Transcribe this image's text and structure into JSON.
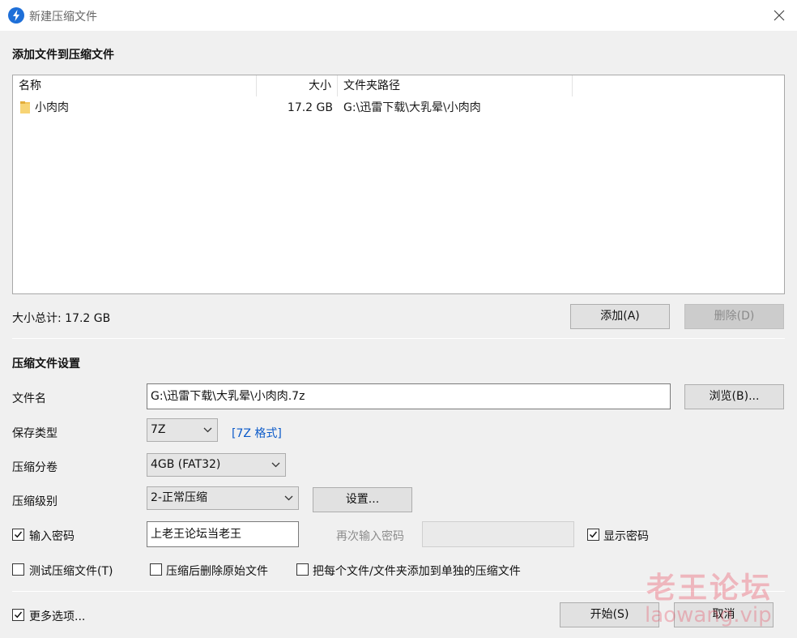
{
  "window": {
    "title": "新建压缩文件",
    "app_icon": "bolt-icon",
    "close_icon": "close-icon"
  },
  "files_section": {
    "title": "添加文件到压缩文件",
    "columns": [
      "名称",
      "大小",
      "文件夹路径"
    ],
    "rows": [
      {
        "name": "小肉肉",
        "size": "17.2 GB",
        "path": "G:\\迅雷下载\\大乳晕\\小肉肉",
        "icon": "folder-icon"
      }
    ],
    "total_size": "大小总计: 17.2 GB",
    "add_button": "添加(A)",
    "delete_button": "删除(D)"
  },
  "settings": {
    "title": "压缩文件设置",
    "filename_label": "文件名",
    "filename_value": "G:\\迅雷下载\\大乳晕\\小肉肉.7z",
    "browse_button": "浏览(B)...",
    "save_type_label": "保存类型",
    "save_type_value": "7Z",
    "format_link": "[7Z 格式]",
    "split_label": "压缩分卷",
    "split_value": "4GB (FAT32)",
    "level_label": "压缩级别",
    "level_value": "2-正常压缩",
    "settings_button": "设置...",
    "password_checkbox": {
      "label": "输入密码",
      "checked": true
    },
    "password_value": "上老王论坛当老王",
    "reenter_password_label": "再次输入密码",
    "reenter_password_value": "",
    "show_password": {
      "label": "显示密码",
      "checked": true
    },
    "test_archive": {
      "label": "测试压缩文件(T)",
      "checked": false
    },
    "delete_after": {
      "label": "压缩后删除原始文件",
      "checked": false
    },
    "separate_archives": {
      "label": "把每个文件/文件夹添加到单独的压缩文件",
      "checked": false
    }
  },
  "footer": {
    "more_options": {
      "label": "更多选项...",
      "checked": true
    },
    "start_button": "开始(S)",
    "cancel_button": "取消"
  },
  "watermark": {
    "text_cn": "老王论坛",
    "text_en": "laowang.vip",
    "color": "#e93a52"
  }
}
